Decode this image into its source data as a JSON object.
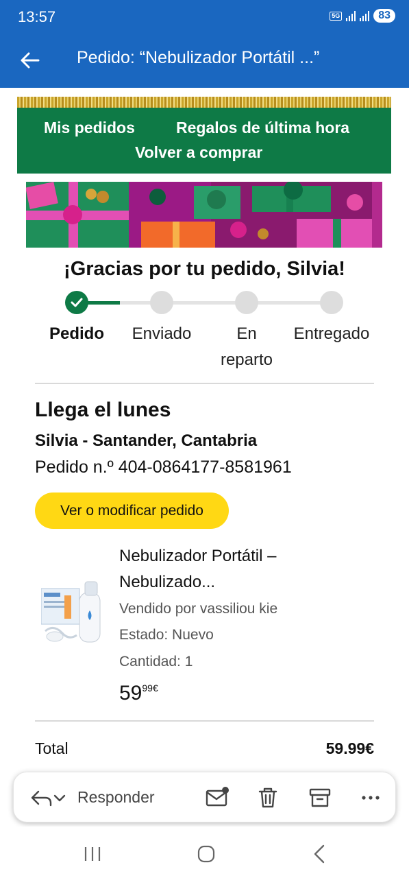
{
  "status_bar": {
    "time": "13:57",
    "network": "5G",
    "battery": "83"
  },
  "app_bar": {
    "title": "Pedido: “Nebulizador Portátil ...”",
    "back_icon": "arrow-left-icon"
  },
  "email": {
    "nav_links": [
      "Mis pedidos",
      "Regalos de última hora",
      "Volver a comprar"
    ],
    "heading": "¡Gracias por tu pedido, Silvia!",
    "tracker": {
      "steps": [
        "Pedido",
        "Enviado",
        "En reparto",
        "Entregado"
      ],
      "current_step": 1,
      "colors": {
        "done": "#0e7a46",
        "pending": "#dddddd"
      }
    },
    "arrival": "Llega el lunes",
    "recipient": "Silvia - Santander, Cantabria",
    "order_number": "Pedido n.º 404-0864177-8581961",
    "modify_button": "Ver o modificar pedido",
    "product": {
      "title_line1": "Nebulizador Portátil –",
      "title_line2": "Nebulizado...",
      "seller": "Vendido por vassiliou kie",
      "condition": "Estado: Nuevo",
      "quantity": "Cantidad: 1",
      "price_whole": "59",
      "price_fraction": "99€"
    },
    "total_label": "Total",
    "total_value": "59.99€"
  },
  "action_bar": {
    "reply_label": "Responder",
    "icons": [
      "reply-icon",
      "chevron-down-icon",
      "mark-unread-icon",
      "trash-icon",
      "archive-icon",
      "more-icon"
    ]
  },
  "system_nav": {
    "icons": [
      "recents-icon",
      "home-icon",
      "back-icon"
    ]
  },
  "colors": {
    "app_bar": "#1a67c0",
    "email_nav": "#0e7a46",
    "button": "#ffd814"
  }
}
